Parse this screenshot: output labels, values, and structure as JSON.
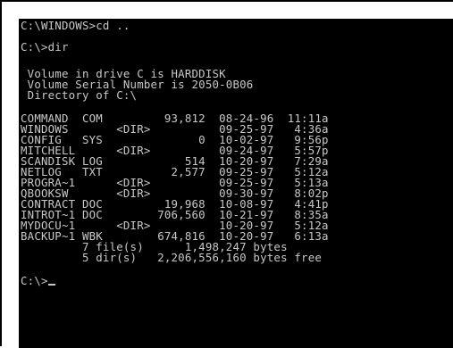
{
  "console": {
    "lines": {
      "cmd_cd": "C:\\WINDOWS>cd ..",
      "cmd_dir": "C:\\>dir",
      "volume_label": " Volume in drive C is HARDDISK",
      "volume_serial": " Volume Serial Number is 2050-0B06",
      "directory_of": " Directory of C:\\",
      "final_prompt": "C:\\>"
    },
    "entries": [
      "COMMAND  COM         93,812  08-24-96  11:11a",
      "WINDOWS       <DIR>          09-25-97   4:36a",
      "CONFIG   SYS              0  10-02-97   9:56p",
      "MITCHELL      <DIR>          09-24-97   5:57p",
      "SCANDISK LOG            514  10-20-97   7:29a",
      "NETLOG   TXT          2,577  09-25-97   5:12a",
      "PROGRA~1      <DIR>          09-25-97   5:13a",
      "QBOOKSW       <DIR>          09-30-97   8:02p",
      "CONTRACT DOC         19,968  10-08-97   4:41p",
      "INTROT~1 DOC        706,560  10-21-97   8:35a",
      "MYDOCU~1      <DIR>          10-20-97   5:12a",
      "BACKUP~1 WBK        674,816  10-20-97   6:13a"
    ],
    "summary": {
      "files": "         7 file(s)      1,498,247 bytes",
      "dirs": "         5 dir(s)   2,206,556,160 bytes free"
    }
  }
}
